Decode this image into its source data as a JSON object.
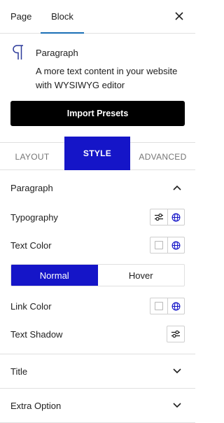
{
  "top_tabs": {
    "page": "Page",
    "block": "Block"
  },
  "block": {
    "name": "Paragraph",
    "description": "A more text content in your website with WYSIWYG editor",
    "icon": "paragraph-icon"
  },
  "import_button": "Import Presets",
  "panel_tabs": {
    "layout": "LAYOUT",
    "style": "STYLE",
    "advanced": "ADVANCED",
    "active": "style"
  },
  "sections": {
    "paragraph": {
      "title": "Paragraph",
      "expanded": true,
      "typography_label": "Typography",
      "text_color_label": "Text Color",
      "state_toggle": {
        "normal": "Normal",
        "hover": "Hover",
        "selected": "Normal"
      },
      "link_color_label": "Link Color",
      "text_shadow_label": "Text Shadow"
    },
    "title": {
      "title": "Title",
      "expanded": false
    },
    "extra_option": {
      "title": "Extra Option",
      "expanded": false
    }
  },
  "colors": {
    "accent": "#1515C8",
    "tab_underline": "#1A6FB6",
    "import_bg": "#000000"
  }
}
